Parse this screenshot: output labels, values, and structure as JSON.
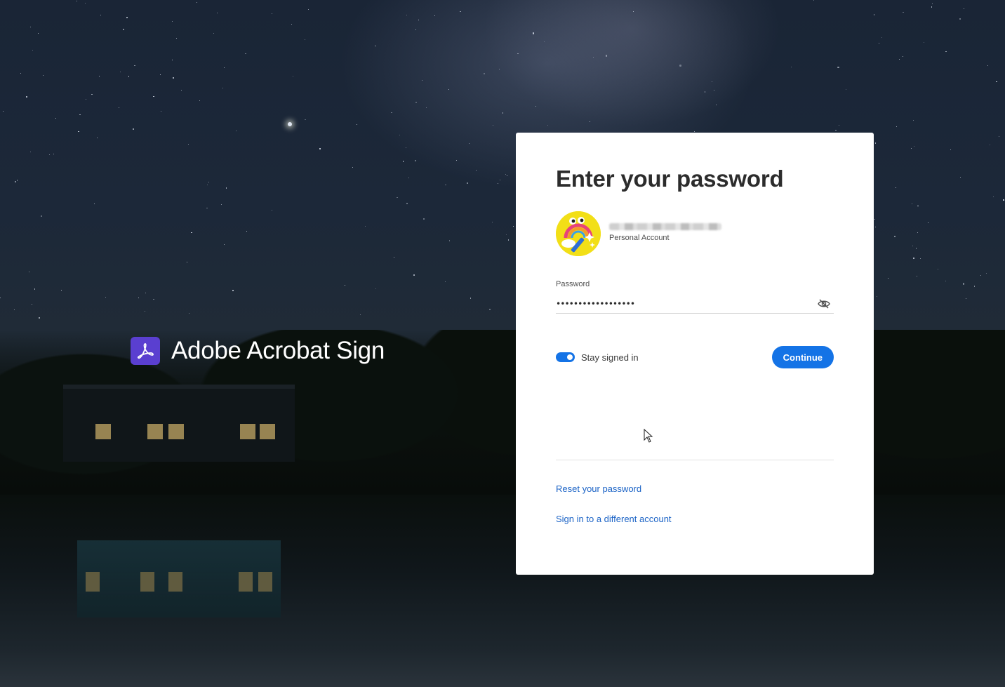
{
  "brand": {
    "name": "Adobe Acrobat Sign",
    "logo_color": "#5a3fd0"
  },
  "card": {
    "title": "Enter your password",
    "account": {
      "email": "••••••••••••",
      "email_state": "blurred",
      "type": "Personal Account",
      "avatar_icon": "rainbow-magic-wand-avatar"
    },
    "password_field": {
      "label": "Password",
      "value": "••••••••••••••••••",
      "toggle_icon": "eye-slash-icon"
    },
    "stay_signed_in": {
      "label": "Stay signed in",
      "checked": true
    },
    "continue_label": "Continue",
    "links": {
      "reset_password": "Reset your password",
      "different_account": "Sign in to a different account"
    }
  },
  "colors": {
    "accent": "#1473e6",
    "link": "#1b63c6",
    "card_bg": "#ffffff"
  }
}
